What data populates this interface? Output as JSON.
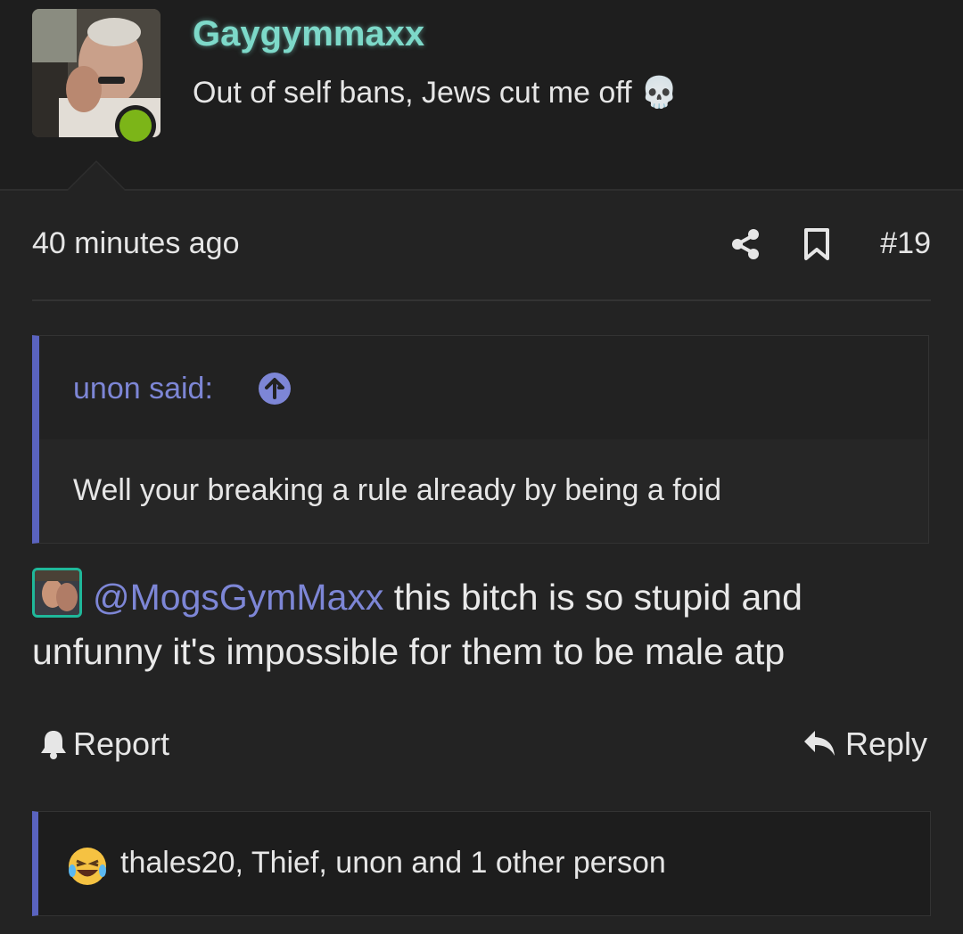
{
  "post": {
    "username": "Gaygymmaxx",
    "tagline": "Out of self bans, Jews cut me off 💀",
    "timestamp": "40 minutes ago",
    "post_number": "#19"
  },
  "quote": {
    "author": "unon said:",
    "text": "Well your breaking a rule already by being a foid"
  },
  "message": {
    "mention": "@MogsGymMaxx",
    "text": " this bitch is so stupid and unfunny it's impossible for them to be male atp"
  },
  "actions": {
    "report_label": "Report",
    "reply_label": "Reply"
  },
  "reactions": {
    "text": "thales20, Thief, unon and 1 other person"
  },
  "colors": {
    "background": "#232323",
    "username": "#7dd9c9",
    "accent": "#5a63bf",
    "mention": "#7d86d6",
    "online": "#7cb518"
  },
  "icons": [
    "share-icon",
    "bookmark-icon",
    "arrow-up-circle-icon",
    "bell-icon",
    "reply-icon",
    "laughing-emoji-icon"
  ]
}
